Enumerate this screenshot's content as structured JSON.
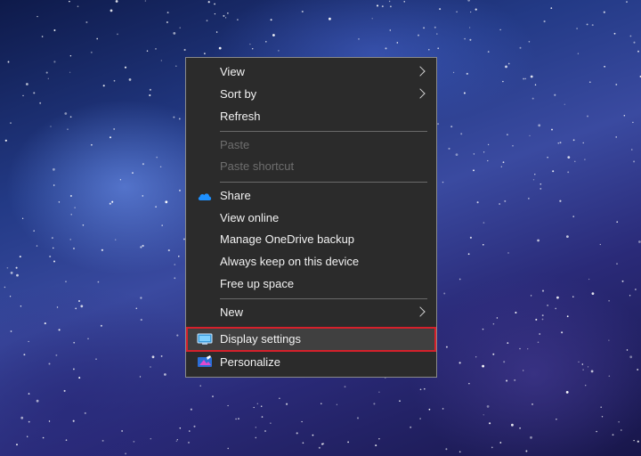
{
  "context_menu": {
    "items": [
      {
        "label": "View",
        "submenu": true,
        "enabled": true
      },
      {
        "label": "Sort by",
        "submenu": true,
        "enabled": true
      },
      {
        "label": "Refresh",
        "submenu": false,
        "enabled": true
      },
      {
        "label": "Paste",
        "submenu": false,
        "enabled": false
      },
      {
        "label": "Paste shortcut",
        "submenu": false,
        "enabled": false
      },
      {
        "label": "Share",
        "submenu": false,
        "enabled": true,
        "icon": "onedrive-cloud-icon"
      },
      {
        "label": "View online",
        "submenu": false,
        "enabled": true
      },
      {
        "label": "Manage OneDrive backup",
        "submenu": false,
        "enabled": true
      },
      {
        "label": "Always keep on this device",
        "submenu": false,
        "enabled": true
      },
      {
        "label": "Free up space",
        "submenu": false,
        "enabled": true
      },
      {
        "label": "New",
        "submenu": true,
        "enabled": true
      },
      {
        "label": "Display settings",
        "submenu": false,
        "enabled": true,
        "icon": "display-settings-icon",
        "highlighted": true
      },
      {
        "label": "Personalize",
        "submenu": false,
        "enabled": true,
        "icon": "personalize-icon"
      }
    ]
  },
  "colors": {
    "menu_background": "#2b2b2b",
    "highlight_border": "#d6202b",
    "onedrive_blue": "#1e90ff"
  }
}
